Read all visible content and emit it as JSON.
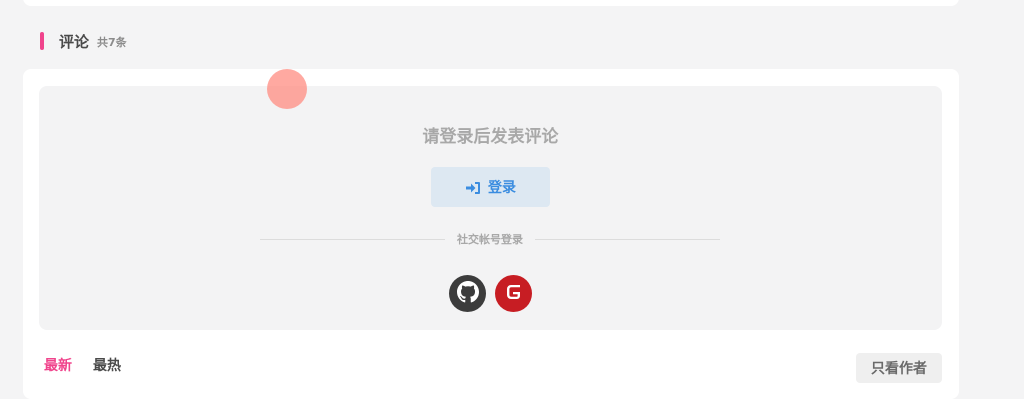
{
  "comments": {
    "section_title": "评论",
    "count_text": "共7条",
    "login_prompt": "请登录后发表评论",
    "login_button": "登录",
    "social_divider": "社交帐号登录",
    "social_providers": [
      {
        "name": "GitHub",
        "icon": "github-icon",
        "color": "#3c3c3c"
      },
      {
        "name": "Gitee",
        "icon": "gitee-icon",
        "color": "#c71d23"
      }
    ],
    "sort_tabs": [
      {
        "label": "最新",
        "active": true
      },
      {
        "label": "最热",
        "active": false
      }
    ],
    "author_only_button": "只看作者"
  },
  "colors": {
    "accent": "#f0448c",
    "login_blue": "#3b8de0",
    "login_button_bg": "#dde8f2",
    "panel_bg": "#f3f3f4",
    "page_bg": "#f4f4f5"
  }
}
